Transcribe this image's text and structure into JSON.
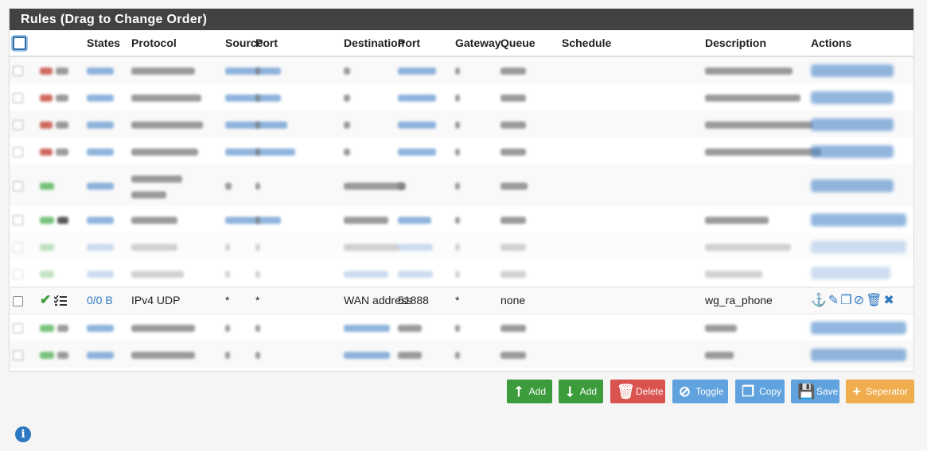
{
  "panel": {
    "title": "Rules (Drag to Change Order)"
  },
  "table": {
    "headers": [
      "States",
      "Protocol",
      "Source",
      "Port",
      "Destination",
      "Port",
      "Gateway",
      "Queue",
      "Schedule",
      "Description",
      "Actions"
    ]
  },
  "focus_row": {
    "states": "0/0 B",
    "protocol": "IPv4 UDP",
    "source": "*",
    "source_port": "*",
    "destination": "WAN address",
    "destination_port": "51888",
    "gateway": "*",
    "queue": "none",
    "schedule": "",
    "description": "wg_ra_phone",
    "actions": [
      "anchor-icon",
      "pencil-icon",
      "copy-icon",
      "ban-icon",
      "trash-icon",
      "x-icon"
    ]
  },
  "buttons": {
    "add_top": "Add",
    "add_bottom": "Add",
    "delete": "Delete",
    "toggle": "Toggle",
    "copy": "Copy",
    "save": "Save",
    "separator": "Seperator"
  },
  "colors": {
    "header_bg": "#424242",
    "add": "#3c9c3c",
    "delete": "#d9534f",
    "toggle": "#5fa2dd",
    "copy": "#5fa2dd",
    "save": "#5fa2dd",
    "separator": "#f0ad4e"
  }
}
